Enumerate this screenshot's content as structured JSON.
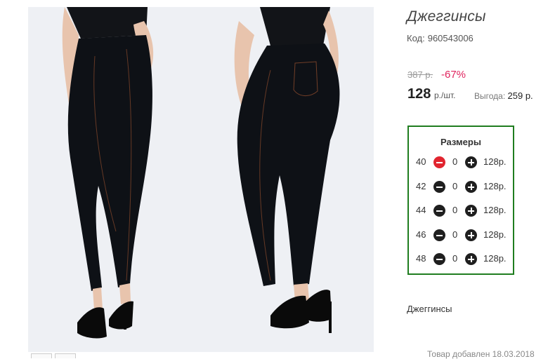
{
  "product": {
    "title": "Джеггинсы",
    "code_label": "Код:",
    "code_value": "960543006",
    "old_price": "387 р.",
    "discount": "-67%",
    "price": "128",
    "price_unit": "р./шт.",
    "savings_label": "Выгода:",
    "savings_value": "259 р.",
    "category": "Джеггинсы",
    "added_text": "Товар добавлен 18.03.2018"
  },
  "sizes": {
    "title": "Размеры",
    "rows": [
      {
        "size": "40",
        "qty": "0",
        "price": "128р.",
        "minus_active": true
      },
      {
        "size": "42",
        "qty": "0",
        "price": "128р.",
        "minus_active": false
      },
      {
        "size": "44",
        "qty": "0",
        "price": "128р.",
        "minus_active": false
      },
      {
        "size": "46",
        "qty": "0",
        "price": "128р.",
        "minus_active": false
      },
      {
        "size": "48",
        "qty": "0",
        "price": "128р.",
        "minus_active": false
      }
    ]
  },
  "colors": {
    "accent_green": "#1f7d1f",
    "discount_red": "#e0245e",
    "minus_active_red": "#e1252f"
  }
}
